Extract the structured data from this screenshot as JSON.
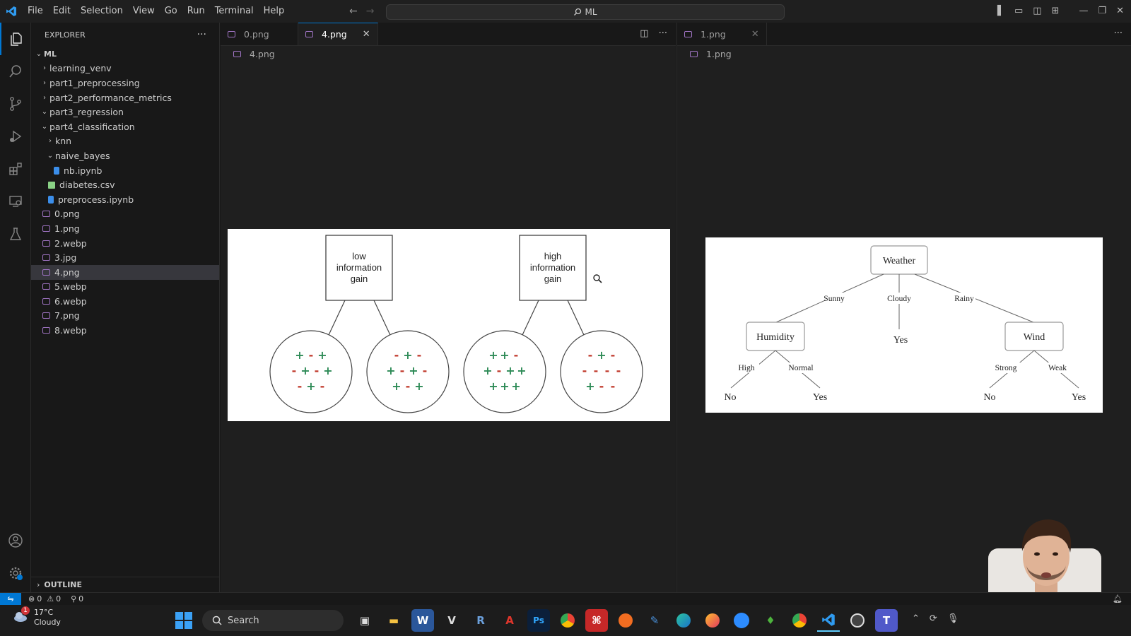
{
  "menu": [
    "File",
    "Edit",
    "Selection",
    "View",
    "Go",
    "Run",
    "Terminal",
    "Help"
  ],
  "search": {
    "text": "ML"
  },
  "explorer": {
    "title": "EXPLORER",
    "more": "···",
    "root": "ML",
    "items": [
      {
        "label": "learning_venv",
        "indent": 1,
        "kind": "folder-closed"
      },
      {
        "label": "part1_preprocessing",
        "indent": 1,
        "kind": "folder-closed"
      },
      {
        "label": "part2_performance_metrics",
        "indent": 1,
        "kind": "folder-closed"
      },
      {
        "label": "part3_regression",
        "indent": 1,
        "kind": "folder-open"
      },
      {
        "label": "part4_classification",
        "indent": 1,
        "kind": "folder-open"
      },
      {
        "label": "knn",
        "indent": 2,
        "kind": "folder-closed"
      },
      {
        "label": "naive_bayes",
        "indent": 2,
        "kind": "folder-open"
      },
      {
        "label": "nb.ipynb",
        "indent": 3,
        "kind": "notebook"
      },
      {
        "label": "diabetes.csv",
        "indent": 2,
        "kind": "csv"
      },
      {
        "label": "preprocess.ipynb",
        "indent": 2,
        "kind": "notebook"
      },
      {
        "label": "0.png",
        "indent": 1,
        "kind": "image"
      },
      {
        "label": "1.png",
        "indent": 1,
        "kind": "image"
      },
      {
        "label": "2.webp",
        "indent": 1,
        "kind": "image"
      },
      {
        "label": "3.jpg",
        "indent": 1,
        "kind": "image"
      },
      {
        "label": "4.png",
        "indent": 1,
        "kind": "image",
        "selected": true
      },
      {
        "label": "5.webp",
        "indent": 1,
        "kind": "image"
      },
      {
        "label": "6.webp",
        "indent": 1,
        "kind": "image"
      },
      {
        "label": "7.png",
        "indent": 1,
        "kind": "image"
      },
      {
        "label": "8.webp",
        "indent": 1,
        "kind": "image"
      }
    ],
    "outline": "OUTLINE"
  },
  "editor1": {
    "tabs": [
      {
        "label": "0.png",
        "active": false
      },
      {
        "label": "4.png",
        "active": true,
        "close": "✕"
      }
    ],
    "breadcrumb": "4.png",
    "image": {
      "left_box": [
        "low",
        "information",
        "gain"
      ],
      "right_box": [
        "high",
        "information",
        "gain"
      ],
      "circles": [
        [
          [
            "+",
            "-",
            "+"
          ],
          [
            "-",
            "+",
            "-",
            "+"
          ],
          [
            "-",
            "+",
            "-"
          ]
        ],
        [
          [
            "-",
            "+",
            "-"
          ],
          [
            "+",
            "-",
            "+",
            "-"
          ],
          [
            "+",
            "-",
            "+"
          ]
        ],
        [
          [
            "+",
            "+",
            "-"
          ],
          [
            "+",
            "-",
            "+",
            "+"
          ],
          [
            "+",
            "+",
            "+"
          ]
        ],
        [
          [
            "-",
            "+",
            "-"
          ],
          [
            "-",
            "-",
            "-",
            "-"
          ],
          [
            "+",
            "-",
            "-"
          ]
        ]
      ]
    }
  },
  "editor2": {
    "tabs": [
      {
        "label": "1.png",
        "active": false,
        "close": "✕"
      }
    ],
    "breadcrumb": "1.png",
    "image": {
      "root": "Weather",
      "edge_sunny": "Sunny",
      "edge_cloudy": "Cloudy",
      "edge_rainy": "Rainy",
      "humidity": "Humidity",
      "cloudy_leaf": "Yes",
      "wind": "Wind",
      "edge_high": "High",
      "edge_normal": "Normal",
      "edge_strong": "Strong",
      "edge_weak": "Weak",
      "leaf_high": "No",
      "leaf_normal": "Yes",
      "leaf_strong": "No",
      "leaf_weak": "Yes"
    }
  },
  "status": {
    "errors": "0",
    "warnings": "0",
    "ports": "0"
  },
  "taskbar": {
    "temp": "17°C",
    "condition": "Cloudy",
    "badge": "1",
    "search": "Search"
  },
  "colors": {
    "accent": "#0078d4",
    "plus": "#2e8b57",
    "minus": "#c0392b"
  }
}
